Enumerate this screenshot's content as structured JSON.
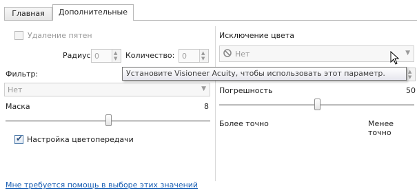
{
  "tabs": [
    {
      "label": "Главная",
      "active": false
    },
    {
      "label": "Дополнительные",
      "active": true
    }
  ],
  "left": {
    "spot_removal": {
      "label": "Удаление пятен",
      "checked": false,
      "enabled": false
    },
    "radius": {
      "label": "Радиус:",
      "value": "0"
    },
    "quantity": {
      "label": "Количество:",
      "value": "0"
    },
    "filter": {
      "label": "Фильтр:",
      "value": "Нет"
    },
    "mask": {
      "label": "Маска",
      "value": "8",
      "slider_fraction": 0.5
    },
    "color_adjust": {
      "label": "Настройка цветопередачи",
      "checked": true
    }
  },
  "right": {
    "color_exclusion": {
      "label": "Исключение цвета",
      "value": "Нет",
      "icon": "no-entry-icon"
    },
    "tolerance": {
      "label": "Погрешность",
      "value": "50",
      "slider_fraction": 0.5
    },
    "more_precise": "Более точно",
    "less_precise": "Менее точно"
  },
  "tooltip": "Установите Visioneer Acuity, чтобы использовать этот параметр.",
  "help_link": "Мне требуется помощь в выборе этих значений"
}
